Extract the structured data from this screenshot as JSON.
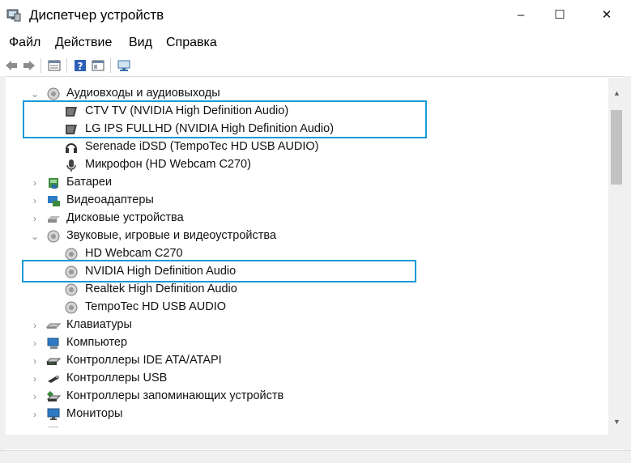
{
  "window": {
    "title": "Диспетчер устройств",
    "minimize": "–",
    "maximize": "☐",
    "close": "✕"
  },
  "menu": [
    "Файл",
    "Действие",
    "Вид",
    "Справка"
  ],
  "toolbar_icons": [
    "back-icon",
    "forward-icon",
    "properties-list-icon",
    "help-icon",
    "view-icon",
    "monitor-scan-icon"
  ],
  "tree": {
    "audio_inputs": {
      "label": "Аудиовходы и аудиовыходы",
      "children": [
        "CTV TV (NVIDIA High Definition Audio)",
        "LG IPS FULLHD (NVIDIA High Definition Audio)",
        "Serenade iDSD (TempoTec HD USB AUDIO)",
        "Микрофон (HD Webcam C270)"
      ]
    },
    "batteries": "Батареи",
    "video_adapters": "Видеоадаптеры",
    "disk_drives": "Дисковые устройства",
    "sound_devices": {
      "label": "Звуковые, игровые и видеоустройства",
      "children": [
        "HD Webcam C270",
        "NVIDIA High Definition Audio",
        "Realtek High Definition Audio",
        "TempoTec HD USB AUDIO"
      ]
    },
    "keyboards": "Клавиатуры",
    "computer": "Компьютер",
    "ide": "Контроллеры IDE ATA/ATAPI",
    "usb": "Контроллеры USB",
    "storage": "Контроллеры запоминающих устройств",
    "monitors": "Мониторы"
  },
  "colors": {
    "highlight": "#1a9ad6",
    "scroll_thumb": "#c2c2c2"
  }
}
